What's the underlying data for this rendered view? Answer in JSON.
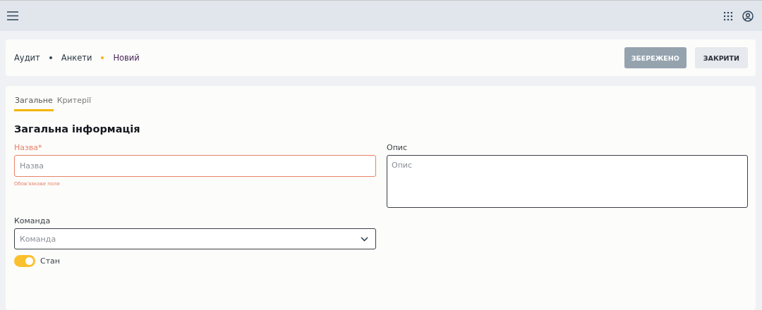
{
  "breadcrumbs": [
    {
      "label": "Аудит",
      "selected": false
    },
    {
      "label": "Анкети",
      "selected": false
    },
    {
      "label": "Новий",
      "selected": true
    }
  ],
  "buttons": [
    {
      "label": "ЗБЕРЕЖЕНО",
      "disabled": true
    },
    {
      "label": "ЗАКРИТИ",
      "disabled": false
    }
  ],
  "tabs": [
    {
      "label": "Загальне",
      "selected": true
    },
    {
      "label": "Критерії",
      "selected": false
    }
  ],
  "section_title": "Загальна інформація",
  "name_field": {
    "label": "Назва*",
    "placeholder": "Назва",
    "error": "Обов'язкове поле"
  },
  "description_field": {
    "label": "Опис",
    "placeholder": "Опис"
  },
  "team_field": {
    "label": "Команда",
    "placeholder": "Команда"
  },
  "status_toggle": {
    "label": "Стан",
    "on": true
  }
}
